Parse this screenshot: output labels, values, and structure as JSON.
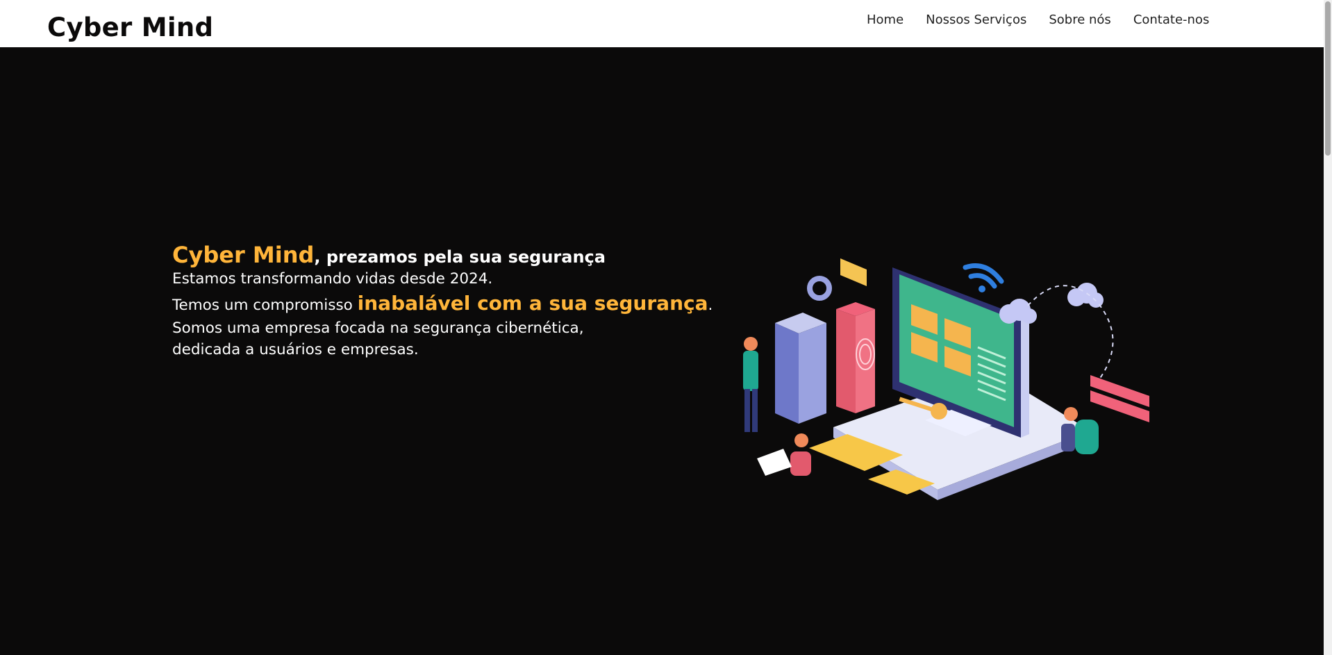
{
  "header": {
    "brand": "Cyber Mind",
    "nav": [
      {
        "label": "Home"
      },
      {
        "label": "Nossos Serviços"
      },
      {
        "label": "Sobre nós"
      },
      {
        "label": "Contate-nos"
      }
    ]
  },
  "hero": {
    "brand_accent": "Cyber Mind",
    "headline_rest": ", prezamos pela sua segurança",
    "line2": "Estamos transformando vidas desde 2024.",
    "line3_prefix": "Temos um compromisso ",
    "line3_accent": "inabalável com a sua segurança",
    "line3_suffix": ".",
    "line4": "Somos uma empresa focada na segurança cibernética,",
    "line5": "dedicada a usuários e empresas."
  },
  "colors": {
    "accent": "#ffb53a",
    "background": "#0b0a0a",
    "header_bg": "#ffffff"
  },
  "illustration": {
    "icon": "cybersecurity-isometric-illustration"
  }
}
